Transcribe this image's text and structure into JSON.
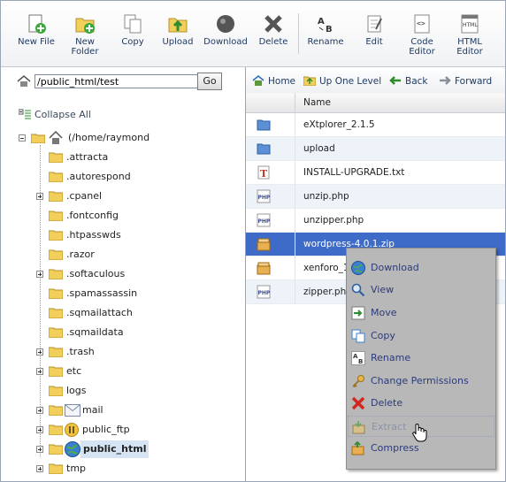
{
  "toolbar": {
    "buttons": [
      {
        "label1": "New File",
        "label2": ""
      },
      {
        "label1": "New",
        "label2": "Folder"
      },
      {
        "label1": "Copy",
        "label2": ""
      },
      {
        "label1": "Upload",
        "label2": ""
      },
      {
        "label1": "Download",
        "label2": ""
      },
      {
        "label1": "Delete",
        "label2": ""
      },
      {
        "label1": "Rename",
        "label2": ""
      },
      {
        "label1": "Edit",
        "label2": ""
      },
      {
        "label1": "Code",
        "label2": "Editor"
      },
      {
        "label1": "HTML",
        "label2": "Editor"
      }
    ]
  },
  "left": {
    "path_value": "/public_html/test",
    "go_label": "Go",
    "collapse_label": "Collapse All",
    "root_label": "(/home/raymond",
    "tree": [
      {
        "label": ".attracta",
        "expander": false
      },
      {
        "label": ".autorespond",
        "expander": false
      },
      {
        "label": ".cpanel",
        "expander": true
      },
      {
        "label": ".fontconfig",
        "expander": false
      },
      {
        "label": ".htpasswds",
        "expander": false
      },
      {
        "label": ".razor",
        "expander": false
      },
      {
        "label": ".softaculous",
        "expander": true
      },
      {
        "label": ".spamassassin",
        "expander": false
      },
      {
        "label": ".sqmailattach",
        "expander": false
      },
      {
        "label": ".sqmaildata",
        "expander": false
      },
      {
        "label": ".trash",
        "expander": true
      },
      {
        "label": "etc",
        "expander": true
      },
      {
        "label": "logs",
        "expander": false
      },
      {
        "label": "mail",
        "expander": true,
        "icon": "mail"
      },
      {
        "label": "public_ftp",
        "expander": true,
        "icon": "ftp"
      },
      {
        "label": "public_html",
        "expander": true,
        "icon": "globe",
        "selected": true
      },
      {
        "label": "tmp",
        "expander": true
      }
    ]
  },
  "right": {
    "nav": {
      "home": "Home",
      "up": "Up One Level",
      "back": "Back",
      "forward": "Forward"
    },
    "column_name": "Name",
    "files": [
      {
        "name": "eXtplorer_2.1.5",
        "icon": "folder"
      },
      {
        "name": "upload",
        "icon": "folder"
      },
      {
        "name": "INSTALL-UPGRADE.txt",
        "icon": "text"
      },
      {
        "name": "unzip.php",
        "icon": "php"
      },
      {
        "name": "unzipper.php",
        "icon": "php"
      },
      {
        "name": "wordpress-4.0.1.zip",
        "icon": "archive",
        "selected": true
      },
      {
        "name": "xenforo_1",
        "icon": "archive"
      },
      {
        "name": "zipper.php",
        "icon": "php"
      }
    ]
  },
  "context_menu": {
    "items": [
      {
        "label": "Download",
        "icon": "download-icon"
      },
      {
        "label": "View",
        "icon": "view-icon"
      },
      {
        "label": "Move",
        "icon": "move-icon"
      },
      {
        "label": "Copy",
        "icon": "copy-icon"
      },
      {
        "label": "Rename",
        "icon": "rename-icon"
      },
      {
        "label": "Change Permissions",
        "icon": "key-icon"
      },
      {
        "label": "Delete",
        "icon": "delete-icon"
      },
      {
        "label": "Extract",
        "icon": "extract-icon",
        "disabled": true
      },
      {
        "label": "Compress",
        "icon": "compress-icon"
      }
    ]
  },
  "colors": {
    "selection_row": "#3d6bc7",
    "link_text": "#1f3a63",
    "menu_bg": "#b8b8b8"
  }
}
